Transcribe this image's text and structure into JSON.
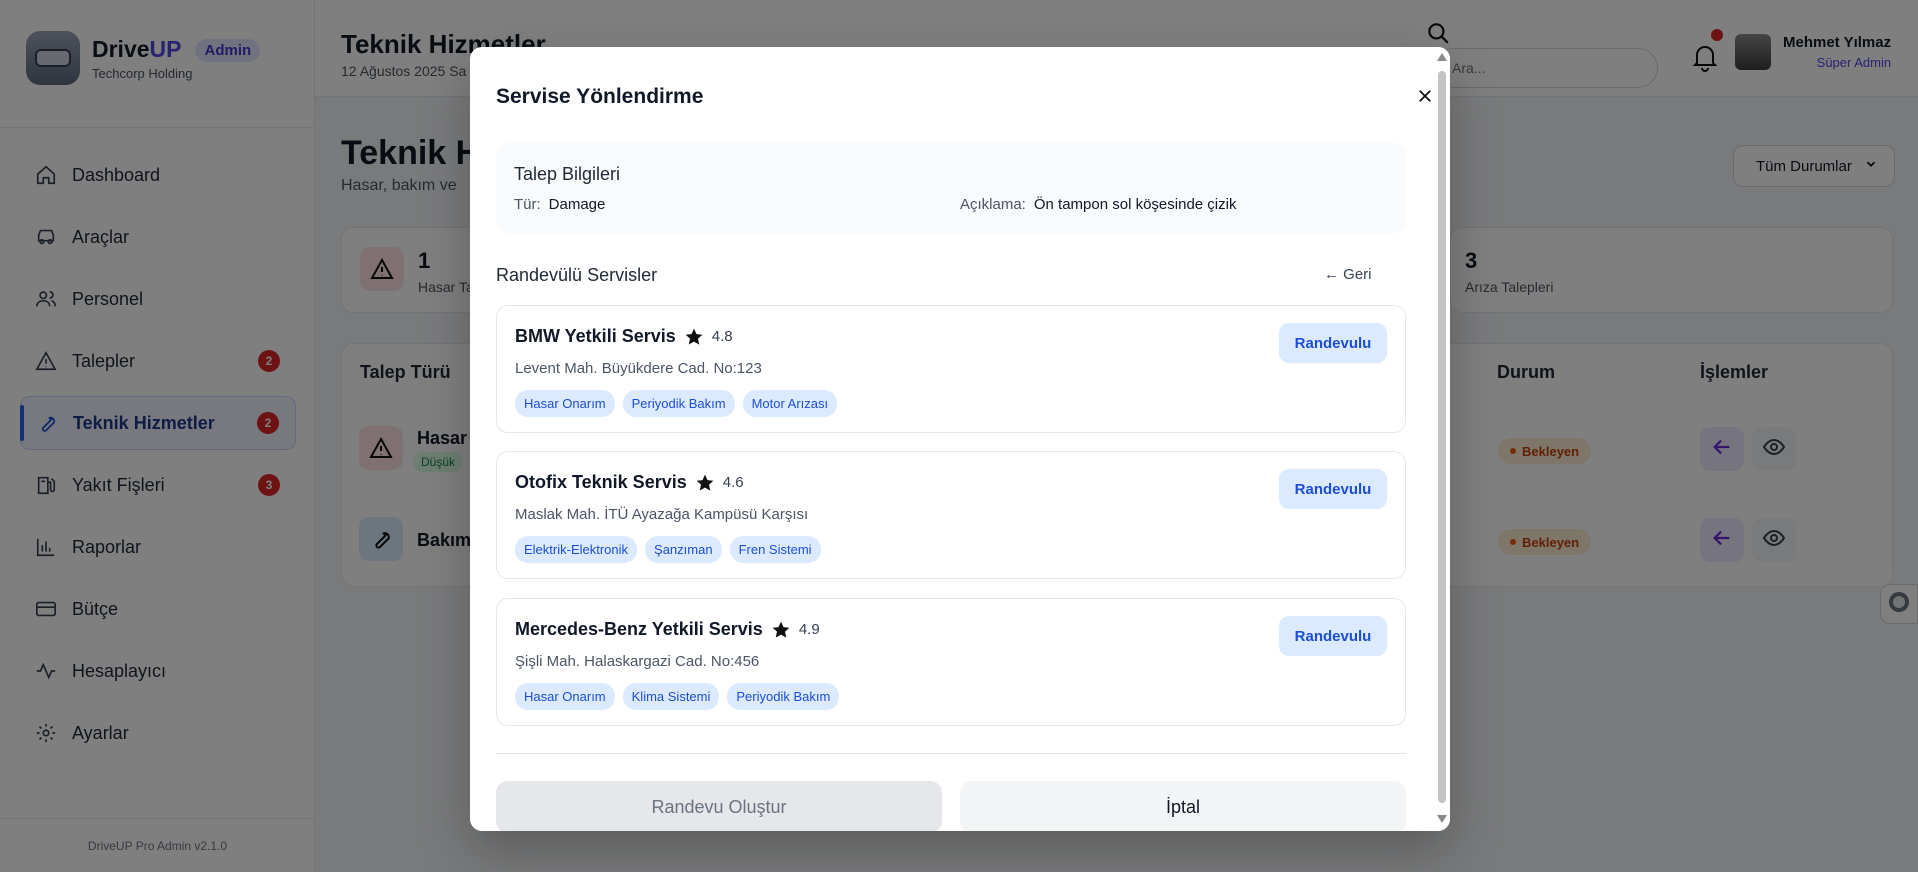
{
  "brand": {
    "name_main": "Drive",
    "name_accent": "UP",
    "badge": "Admin",
    "subtitle": "Techcorp Holding"
  },
  "sidebar": {
    "items": [
      {
        "label": "Dashboard",
        "icon": "home-icon",
        "badge": ""
      },
      {
        "label": "Araçlar",
        "icon": "car-icon",
        "badge": ""
      },
      {
        "label": "Personel",
        "icon": "users-icon",
        "badge": ""
      },
      {
        "label": "Talepler",
        "icon": "warning-icon",
        "badge": "2"
      },
      {
        "label": "Teknik Hizmetler",
        "icon": "wrench-icon",
        "badge": "2"
      },
      {
        "label": "Yakıt Fişleri",
        "icon": "fuel-icon",
        "badge": "3"
      },
      {
        "label": "Raporlar",
        "icon": "bar-chart-icon",
        "badge": ""
      },
      {
        "label": "Bütçe",
        "icon": "card-icon",
        "badge": ""
      },
      {
        "label": "Hesaplayıcı",
        "icon": "activity-icon",
        "badge": ""
      },
      {
        "label": "Ayarlar",
        "icon": "gear-icon",
        "badge": ""
      }
    ],
    "active_index": 4,
    "version": "DriveUP Pro Admin v2.1.0"
  },
  "header": {
    "title": "Teknik Hizmetler",
    "date": "12 Ağustos 2025 Sa",
    "search_placeholder": "Ara...",
    "user_name": "Mehmet Yılmaz",
    "user_role": "Süper Admin"
  },
  "main": {
    "title": "Teknik H",
    "subtitle": "Hasar, bakım ve",
    "status_filter": "Tüm Durumlar",
    "stats": [
      {
        "value": "1",
        "label": "Hasar Ta"
      },
      {
        "value": "3",
        "label": "Arıza Talepleri"
      }
    ],
    "table": {
      "headers": {
        "type": "Talep Türü",
        "status": "Durum",
        "actions": "İşlemler"
      },
      "rows": [
        {
          "type": "Hasar",
          "priority": "Düşük",
          "status": "Bekleyen"
        },
        {
          "type": "Bakım",
          "priority": "",
          "status": "Bekleyen"
        }
      ]
    }
  },
  "modal": {
    "title": "Servise Yönlendirme",
    "info": {
      "title": "Talep Bilgileri",
      "type_label": "Tür:",
      "type_value": "Damage",
      "desc_label": "Açıklama:",
      "desc_value": "Ön tampon sol köşesinde çizik"
    },
    "section_title": "Randevülü Servisler",
    "back_label": "← Geri",
    "services": [
      {
        "name": "BMW Yetkili Servis",
        "rating": "4.8",
        "address": "Levent Mah. Büyükdere Cad. No:123",
        "tags": [
          "Hasar Onarım",
          "Periyodik Bakım",
          "Motor Arızası"
        ],
        "button": "Randevulu"
      },
      {
        "name": "Otofix Teknik Servis",
        "rating": "4.6",
        "address": "Maslak Mah. İTÜ Ayazağa Kampüsü Karşısı",
        "tags": [
          "Elektrik-Elektronik",
          "Şanzıman",
          "Fren Sistemi"
        ],
        "button": "Randevulu"
      },
      {
        "name": "Mercedes-Benz Yetkili Servis",
        "rating": "4.9",
        "address": "Şişli Mah. Halaskargazi Cad. No:456",
        "tags": [
          "Hasar Onarım",
          "Klima Sistemi",
          "Periyodik Bakım"
        ],
        "button": "Randevulu"
      }
    ],
    "create_label": "Randevu Oluştur",
    "cancel_label": "İptal"
  }
}
